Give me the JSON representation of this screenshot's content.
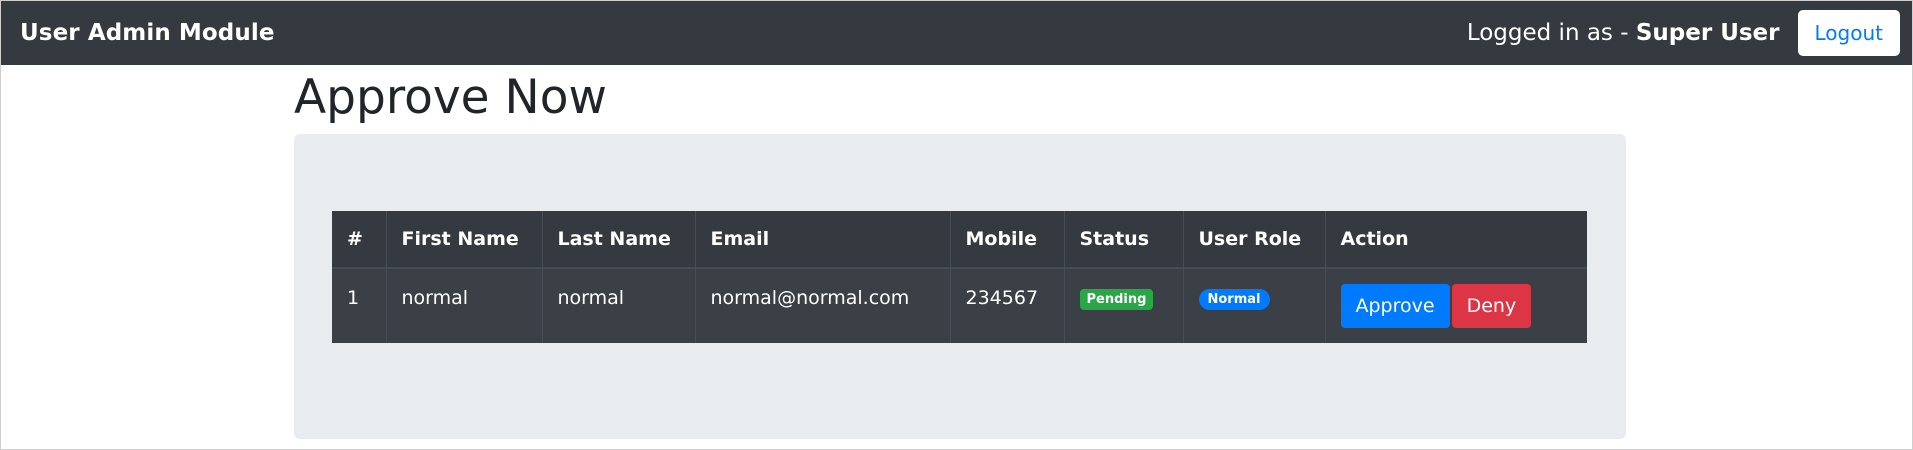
{
  "navbar": {
    "brand": "User Admin Module",
    "logged_prefix": "Logged in as - ",
    "logged_user": "Super User",
    "logout_label": "Logout"
  },
  "page": {
    "title": "Approve Now"
  },
  "table": {
    "headers": [
      "#",
      "First Name",
      "Last Name",
      "Email",
      "Mobile",
      "Status",
      "User Role",
      "Action"
    ],
    "rows": [
      {
        "index": "1",
        "first_name": "normal",
        "last_name": "normal",
        "email": "normal@normal.com",
        "mobile": "234567",
        "status": "Pending",
        "role": "Normal",
        "approve_label": "Approve",
        "deny_label": "Deny"
      }
    ]
  },
  "colors": {
    "navbar_bg": "#343a40",
    "primary": "#007bff",
    "success": "#28a745",
    "danger": "#dc3545",
    "jumbotron_bg": "#e9ecef"
  }
}
